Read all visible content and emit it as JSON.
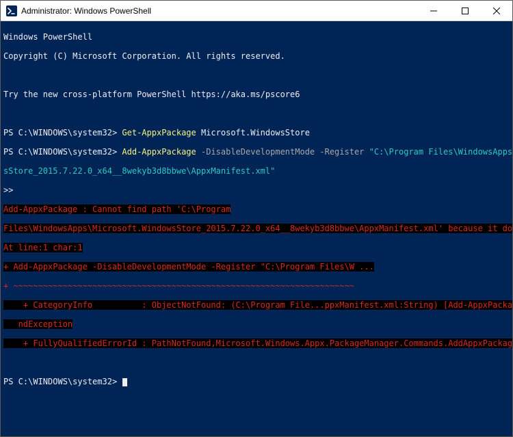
{
  "titlebar": {
    "title": "Administrator: Windows PowerShell"
  },
  "banner": {
    "l1": "Windows PowerShell",
    "l2": "Copyright (C) Microsoft Corporation. All rights reserved.",
    "l3": "Try the new cross-platform PowerShell https://aka.ms/pscore6"
  },
  "cmd1": {
    "prompt": "PS C:\\WINDOWS\\system32> ",
    "cmd": "Get-AppxPackage ",
    "arg": "Microsoft.WindowsStore"
  },
  "cmd2": {
    "prompt": "PS C:\\WINDOWS\\system32> ",
    "cmd": "Add-AppxPackage ",
    "flag1": "-DisableDevelopmentMode ",
    "flag2": "-Register ",
    "path1": "\"C:\\Program Files\\WindowsApps\\Microsoft.Window",
    "path2": "sStore_2015.7.22.0_x64__8wekyb3d8bbwe\\AppxManifest.xml\"",
    "cont": ">>"
  },
  "err": {
    "l1": "Add-AppxPackage : Cannot find path 'C:\\Program",
    "l2": "Files\\WindowsApps\\Microsoft.WindowsStore_2015.7.22.0_x64__8wekyb3d8bbwe\\AppxManifest.xml' because it does not exist.",
    "l3": "At line:1 char:1",
    "l4": "+ Add-AppxPackage -DisableDevelopmentMode -Register \"C:\\Program Files\\W ...",
    "l5": "+ ~~~~~~~~~~~~~~~~~~~~~~~~~~~~~~~~~~~~~~~~~~~~~~~~~~~~~~~~~~~~~~~~~~~~~",
    "l6a": "    + CategoryInfo          : ObjectNotFound: (C:\\Program File...ppxManifest.xml:String) [Add-AppxPackage], ItemNotFou",
    "l6b": "   ndException",
    "l7": "    + FullyQualifiedErrorId : PathNotFound,Microsoft.Windows.Appx.PackageManager.Commands.AddAppxPackageCommand"
  },
  "prompt_final": "PS C:\\WINDOWS\\system32>"
}
